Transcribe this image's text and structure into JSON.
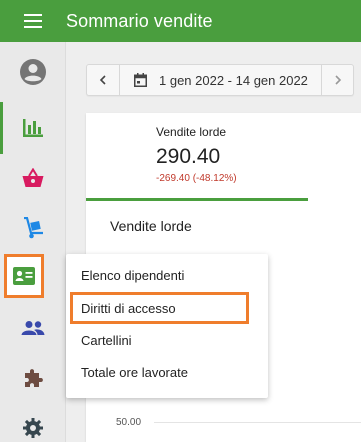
{
  "header": {
    "title": "Sommario vendite",
    "menu_icon": "hamburger-menu-icon",
    "bg_color": "#4a9e3e"
  },
  "sidebar": {
    "items": [
      {
        "name": "account",
        "icon": "account-circle-icon",
        "color": "#757575"
      },
      {
        "name": "reports",
        "icon": "bar-chart-icon",
        "color": "#4a9e3e",
        "active": true
      },
      {
        "name": "sales",
        "icon": "basket-icon",
        "color": "#d81b60"
      },
      {
        "name": "inventory",
        "icon": "hand-truck-icon",
        "color": "#1e88e5"
      },
      {
        "name": "employees",
        "icon": "badge-icon",
        "color": "#4a9e3e",
        "highlighted": true
      },
      {
        "name": "customers",
        "icon": "people-icon",
        "color": "#3949ab"
      },
      {
        "name": "integrations",
        "icon": "puzzle-icon",
        "color": "#6d4c41"
      },
      {
        "name": "settings",
        "icon": "gear-icon",
        "color": "#37474f"
      }
    ]
  },
  "date_filter": {
    "range": "1 gen 2022 - 14 gen 2022",
    "prev_icon": "chevron-left-icon",
    "next_icon": "chevron-right-icon",
    "calendar_icon": "calendar-icon"
  },
  "metric": {
    "label": "Vendite lorde",
    "value": "290.40",
    "change": "-269.40 (-48.12%)",
    "change_color": "#c0392b"
  },
  "chart": {
    "title": "Vendite lorde",
    "tick": "50.00"
  },
  "employee_menu": {
    "items": [
      {
        "label": "Elenco dipendenti"
      },
      {
        "label": "Diritti di accesso",
        "highlighted": true
      },
      {
        "label": "Cartellini"
      },
      {
        "label": "Totale ore lavorate"
      }
    ]
  },
  "annotation_color": "#ef7d2c"
}
